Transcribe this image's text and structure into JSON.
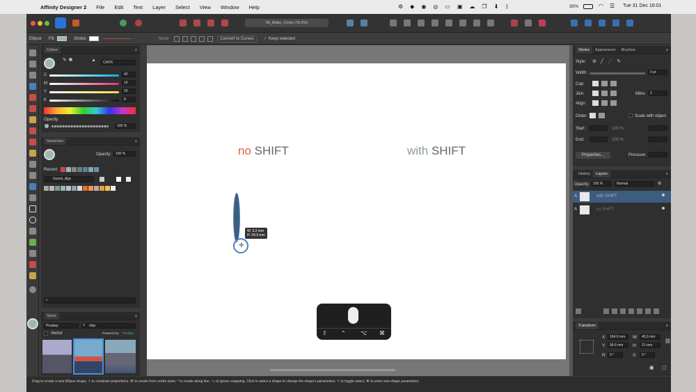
{
  "menubar": {
    "app_name": "Affinity Designer 2",
    "menus": [
      "File",
      "Edit",
      "Text",
      "Layer",
      "Select",
      "View",
      "Window",
      "Help"
    ],
    "battery": "30%",
    "datetime": "Tue 31 Dec  16:01"
  },
  "titlebar": {
    "document": "05_Make_Circle (75.5%)"
  },
  "context_toolbar": {
    "tool_name": "Ellipse",
    "fill_label": "Fill:",
    "stroke_label": "Stroke:",
    "stroke_value": "None",
    "convert_label": "Convert to Curves",
    "keep_selected_label": "Keep selected"
  },
  "colour_panel": {
    "tab": "Colour",
    "model": "CMYK",
    "channels": [
      {
        "label": "C",
        "value": "40"
      },
      {
        "label": "M",
        "value": "16"
      },
      {
        "label": "Y",
        "value": "29"
      },
      {
        "label": "K",
        "value": "8"
      }
    ],
    "opacity_label": "Opacity",
    "opacity_value": "100 %"
  },
  "swatches_panel": {
    "tab": "Swatches",
    "opacity_label": "Opacity:",
    "opacity_value": "100 %",
    "recent_label": "Recent:",
    "palette_name": "Suomi_App"
  },
  "stock_panel": {
    "tab": "Stock",
    "source": "Pixabay",
    "search_value": "ship",
    "vector_label": "Vector",
    "powered_by": "Powered by",
    "powered_by_brand": "Pixabay"
  },
  "canvas": {
    "left_heading_a": "no",
    "left_heading_b": " SHIFT",
    "right_heading_a": "with",
    "right_heading_b": " SHIFT",
    "tooltip_w": "W: 3.2 mm",
    "tooltip_h": "H: 34.9 mm"
  },
  "stroke_panel": {
    "tabs": [
      "Stroke",
      "Appearance",
      "Brushes"
    ],
    "style_label": "Style:",
    "width_label": "Width:",
    "width_value": "0 pt",
    "cap_label": "Cap:",
    "join_label": "Join:",
    "mitre_label": "Mitre:",
    "mitre_value": "2",
    "align_label": "Align:",
    "order_label": "Order:",
    "scale_label": "Scale with object",
    "start_label": "Start:",
    "start_pct": "100 %",
    "end_label": "End:",
    "end_pct": "100 %",
    "properties_button": "Properties...",
    "pressure_label": "Pressure:"
  },
  "layers_panel": {
    "tabs": [
      "History",
      "Layers"
    ],
    "opacity_label": "Opacity:",
    "opacity_value": "100 %",
    "blend_mode": "Normal",
    "layers": [
      {
        "name": "with SHIFT",
        "selected": true
      },
      {
        "name": "no SHIFT",
        "selected": false
      }
    ]
  },
  "transform_panel": {
    "tab": "Transform",
    "x_label": "X:",
    "x_value": "164.9 mm",
    "y_label": "Y:",
    "y_value": "58.6 mm",
    "w_label": "W:",
    "w_value": "45.9 mm",
    "h_label": "H:",
    "h_value": "21 mm",
    "r_label": "R:",
    "r_value": "0 °",
    "s_label": "S:",
    "s_value": "0 °"
  },
  "status_bar": {
    "text": "Drag to create a new Ellipse shape, ⇧ to constrain proportions, ⌘ to create from centre point, ^ to create along line, ⌥ to ignore snapping. Click to select a shape to change the shape's parameters, ⇧ to toggle select, ⌘ to enter new shape parameters"
  },
  "colors": {
    "accent": "#4a90d9",
    "orange_text": "#e0603a",
    "grey_text": "#8c9aa0",
    "ellipse_fill": "#3b5f7e",
    "fill_swatch": "#9fb8ae"
  }
}
